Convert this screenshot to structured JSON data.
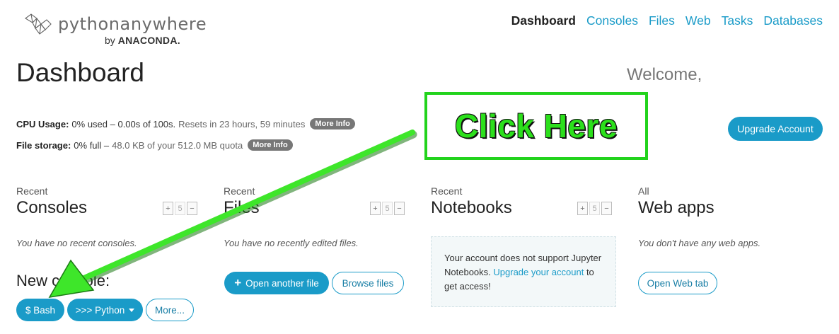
{
  "brand": {
    "wordmark": "pythonanywhere",
    "by": "by",
    "company": "ANACONDA."
  },
  "nav": {
    "items": [
      "Dashboard",
      "Consoles",
      "Files",
      "Web",
      "Tasks",
      "Databases"
    ],
    "active": "Dashboard"
  },
  "page": {
    "title": "Dashboard",
    "welcome": "Welcome,"
  },
  "usage": {
    "cpu_label": "CPU Usage:",
    "cpu_value": "0% used – 0.00s of 100s.",
    "cpu_reset": "Resets in 23 hours, 59 minutes",
    "storage_label": "File storage:",
    "storage_value": "0% full –",
    "storage_detail": "48.0 KB of your 512.0 MB quota",
    "more_info": "More Info"
  },
  "upgrade_button": "Upgrade Account",
  "callout": {
    "text": "Click Here",
    "color": "#22d31c"
  },
  "columns": {
    "consoles": {
      "small": "Recent",
      "big": "Consoles",
      "count": "5",
      "empty": "You have no recent consoles."
    },
    "files": {
      "small": "Recent",
      "big": "Files",
      "count": "5",
      "empty": "You have no recently edited files."
    },
    "notebooks": {
      "small": "Recent",
      "big": "Notebooks",
      "count": "5",
      "notice_before": "Your account does not support Jupyter Notebooks.",
      "notice_link": "Upgrade your account",
      "notice_after": "to get access!"
    },
    "webapps": {
      "small": "All",
      "big": "Web apps",
      "empty": "You don't have any web apps."
    }
  },
  "stepper": {
    "minus": "−",
    "plus": "+"
  },
  "new_console": {
    "label": "New console:",
    "bash": "$ Bash",
    "python": ">>> Python",
    "more": "More..."
  },
  "files_actions": {
    "open_another": "Open another file",
    "browse": "Browse files"
  },
  "web_actions": {
    "open_tab": "Open Web tab"
  },
  "colors": {
    "accent": "#1a9bc8",
    "badge": "#777777",
    "highlight": "#22d31c"
  }
}
